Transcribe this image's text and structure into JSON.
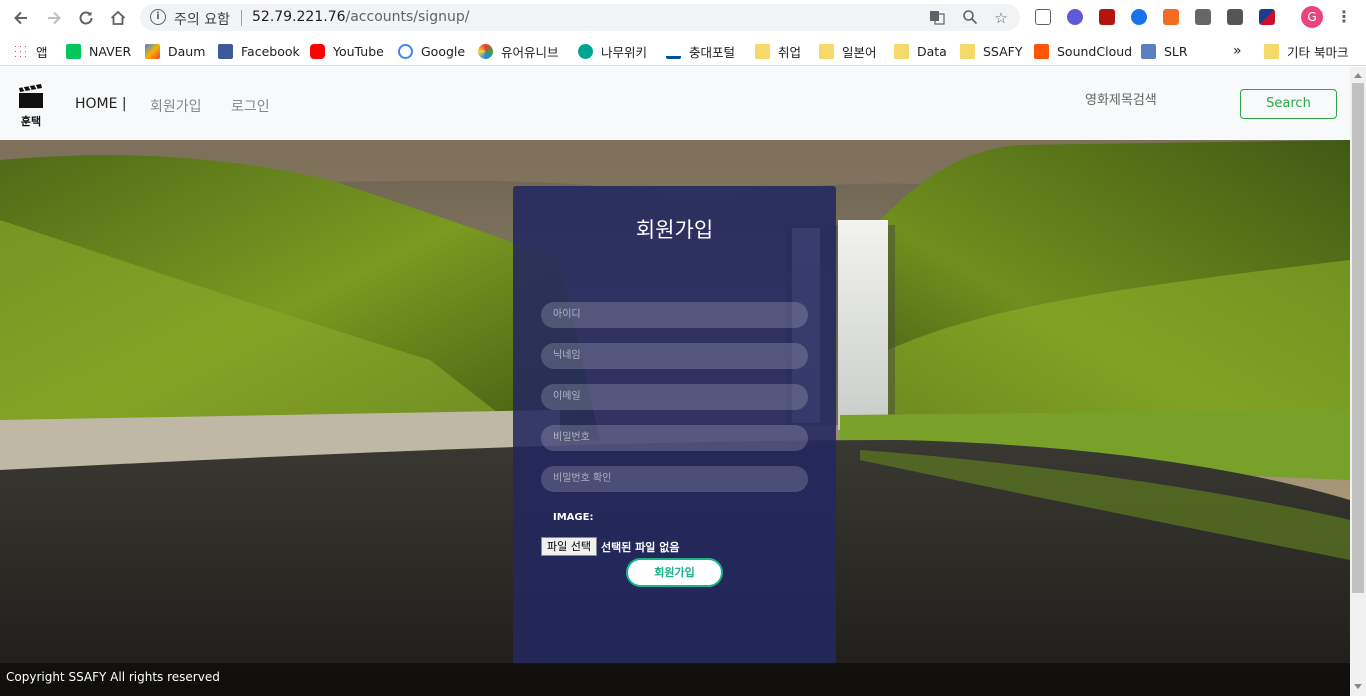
{
  "browser": {
    "security_warning": "주의 요함",
    "url_host": "52.79.221.76",
    "url_path": "/accounts/signup/",
    "profile_initial": "G",
    "bookmarks": [
      {
        "label": "앱"
      },
      {
        "label": "NAVER"
      },
      {
        "label": "Daum"
      },
      {
        "label": "Facebook"
      },
      {
        "label": "YouTube"
      },
      {
        "label": "Google"
      },
      {
        "label": "유어유니브"
      },
      {
        "label": "나무위키"
      },
      {
        "label": "충대포털"
      },
      {
        "label": "취업"
      },
      {
        "label": "일본어"
      },
      {
        "label": "Data"
      },
      {
        "label": "SSAFY"
      },
      {
        "label": "SoundCloud"
      },
      {
        "label": "SLR"
      }
    ],
    "more": "»",
    "other_bookmarks": "기타 북마크"
  },
  "site": {
    "logo_text": "훈택",
    "nav": {
      "home": "HOME |",
      "signup": "회원가입",
      "login": "로그인"
    },
    "search_label": "영화제목검색",
    "search_button": "Search"
  },
  "form": {
    "title": "회원가입",
    "fields": {
      "username": "아이디",
      "nickname": "닉네임",
      "email": "이메일",
      "password": "비밀번호",
      "password_confirm": "비밀번호 확인"
    },
    "image_label": "IMAGE:",
    "file_button": "파일 선택",
    "file_status": "선택된 파일 없음",
    "submit": "회원가입"
  },
  "footer": {
    "copyright": "Copyright SSAFY All rights reserved"
  }
}
